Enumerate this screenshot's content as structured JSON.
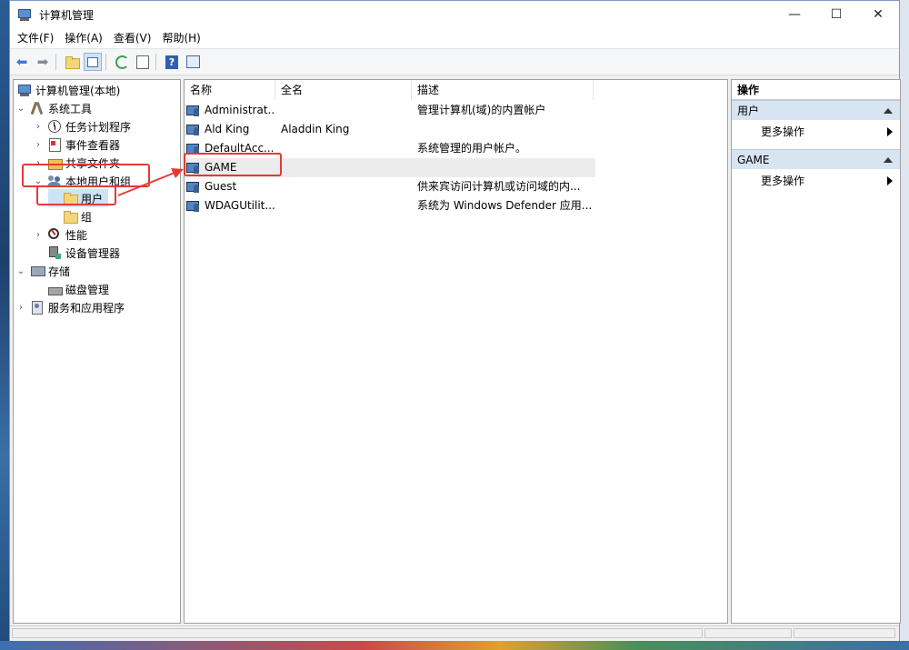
{
  "window": {
    "title": "计算机管理",
    "controls": {
      "minimize": "—",
      "maximize": "☐",
      "close": "✕"
    }
  },
  "menubar": [
    {
      "label": "文件(F)"
    },
    {
      "label": "操作(A)"
    },
    {
      "label": "查看(V)"
    },
    {
      "label": "帮助(H)"
    }
  ],
  "toolbar": {
    "icons": [
      "back-icon",
      "forward-icon",
      "up-folder-icon",
      "show-tree-icon",
      "refresh-icon",
      "export-icon",
      "help-icon",
      "properties-icon"
    ],
    "glyphs": {
      "back": "⬅",
      "forward": "➡",
      "help": "?"
    }
  },
  "tree": {
    "root": "计算机管理(本地)",
    "system_tools": "系统工具",
    "task_scheduler": "任务计划程序",
    "event_viewer": "事件查看器",
    "shared_folders": "共享文件夹",
    "local_users_groups": "本地用户和组",
    "users": "用户",
    "groups": "组",
    "performance": "性能",
    "device_manager": "设备管理器",
    "storage": "存储",
    "disk_management": "磁盘管理",
    "services_apps": "服务和应用程序",
    "chevrons": {
      "expanded": "⌄",
      "collapsed": "›"
    }
  },
  "list": {
    "columns": {
      "name": "名称",
      "fullname": "全名",
      "description": "描述"
    },
    "rows": [
      {
        "name": "Administrat...",
        "fullname": "",
        "description": "管理计算机(域)的内置帐户"
      },
      {
        "name": "Ald King",
        "fullname": "Aladdin King",
        "description": ""
      },
      {
        "name": "DefaultAcc...",
        "fullname": "",
        "description": "系统管理的用户帐户。"
      },
      {
        "name": "GAME",
        "fullname": "",
        "description": ""
      },
      {
        "name": "Guest",
        "fullname": "",
        "description": "供来宾访问计算机或访问域的内..."
      },
      {
        "name": "WDAGUtilit...",
        "fullname": "",
        "description": "系统为 Windows Defender 应用..."
      }
    ]
  },
  "actions": {
    "header": "操作",
    "sections": [
      {
        "title": "用户",
        "item": "更多操作"
      },
      {
        "title": "GAME",
        "item": "更多操作"
      }
    ]
  },
  "colors": {
    "annotation": "#e53935",
    "section_bg": "#d7e4f2"
  }
}
